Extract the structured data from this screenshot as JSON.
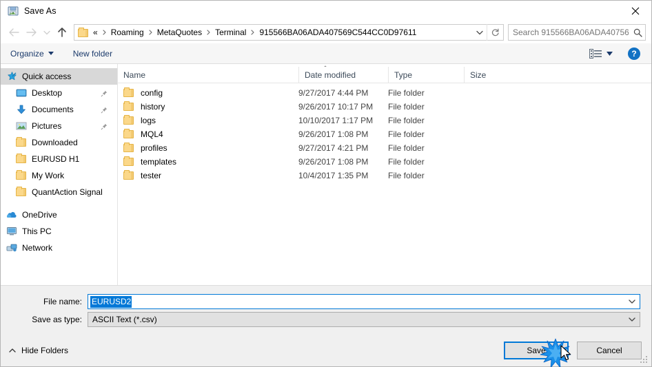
{
  "window": {
    "title": "Save As",
    "title_icon": "save-as-icon",
    "close_icon": "close-icon"
  },
  "nav": {
    "back_icon": "back-arrow-icon",
    "forward_icon": "forward-arrow-icon",
    "recent_icon": "recent-locations-chevron-icon",
    "up_icon": "up-arrow-icon",
    "breadcrumbs": [
      "Roaming",
      "MetaQuotes",
      "Terminal",
      "915566BA06ADA407569C544CC0D97611"
    ],
    "breadcrumb_prefix": "«",
    "dropdown_icon": "address-dropdown-icon",
    "refresh_icon": "refresh-icon"
  },
  "search": {
    "placeholder": "Search 915566BA06ADA40756...",
    "icon": "search-icon"
  },
  "commandbar": {
    "organize": "Organize",
    "new_folder": "New folder",
    "view_icon": "view-layout-icon",
    "help_label": "?",
    "help_icon": "help-icon"
  },
  "sidebar": {
    "items": [
      {
        "label": "Quick access",
        "icon": "star-icon",
        "selected": true,
        "pinned": false,
        "indent": false
      },
      {
        "label": "Desktop",
        "icon": "desktop-icon",
        "selected": false,
        "pinned": true,
        "indent": true
      },
      {
        "label": "Documents",
        "icon": "documents-icon",
        "selected": false,
        "pinned": true,
        "indent": true
      },
      {
        "label": "Pictures",
        "icon": "pictures-icon",
        "selected": false,
        "pinned": true,
        "indent": true
      },
      {
        "label": "Downloaded",
        "icon": "folder-icon",
        "selected": false,
        "pinned": false,
        "indent": true
      },
      {
        "label": "EURUSD H1",
        "icon": "folder-icon",
        "selected": false,
        "pinned": false,
        "indent": true
      },
      {
        "label": "My Work",
        "icon": "folder-icon",
        "selected": false,
        "pinned": false,
        "indent": true
      },
      {
        "label": "QuantAction Signal",
        "icon": "folder-icon",
        "selected": false,
        "pinned": false,
        "indent": true
      }
    ],
    "roots": [
      {
        "label": "OneDrive",
        "icon": "onedrive-icon"
      },
      {
        "label": "This PC",
        "icon": "this-pc-icon"
      },
      {
        "label": "Network",
        "icon": "network-icon"
      }
    ]
  },
  "filelist": {
    "sort_indicator_icon": "sort-ascending-icon",
    "columns": [
      "Name",
      "Date modified",
      "Type",
      "Size"
    ],
    "rows": [
      {
        "name": "config",
        "date": "9/27/2017 4:44 PM",
        "type": "File folder",
        "size": ""
      },
      {
        "name": "history",
        "date": "9/26/2017 10:17 PM",
        "type": "File folder",
        "size": ""
      },
      {
        "name": "logs",
        "date": "10/10/2017 1:17 PM",
        "type": "File folder",
        "size": ""
      },
      {
        "name": "MQL4",
        "date": "9/26/2017 1:08 PM",
        "type": "File folder",
        "size": ""
      },
      {
        "name": "profiles",
        "date": "9/27/2017 4:21 PM",
        "type": "File folder",
        "size": ""
      },
      {
        "name": "templates",
        "date": "9/26/2017 1:08 PM",
        "type": "File folder",
        "size": ""
      },
      {
        "name": "tester",
        "date": "10/4/2017 1:35 PM",
        "type": "File folder",
        "size": ""
      }
    ]
  },
  "form": {
    "filename_label": "File name:",
    "filename_value": "EURUSD2",
    "savetype_label": "Save as type:",
    "savetype_value": "ASCII Text (*.csv)",
    "dropdown_icon": "chevron-down-icon"
  },
  "footer": {
    "hide_folders": "Hide Folders",
    "hide_folders_icon": "chevron-up-icon",
    "save_label": "Save",
    "cancel_label": "Cancel",
    "resize_grip_icon": "resize-grip-icon"
  },
  "overlay": {
    "click_burst_icon": "click-burst-icon",
    "cursor_icon": "mouse-cursor-icon"
  },
  "colors": {
    "accent": "#0078d7",
    "selection": "#0078d7",
    "folder": "#fbd88a",
    "crumb_text": "#000000",
    "header_text": "#3c4a59",
    "command_text": "#1b3a6b"
  }
}
